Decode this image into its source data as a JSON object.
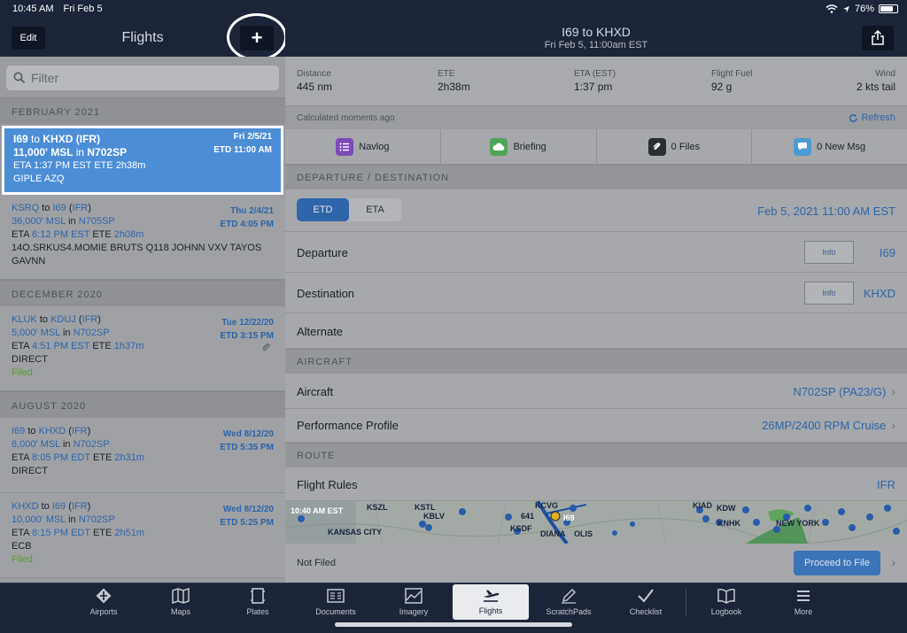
{
  "status": {
    "time": "10:45 AM",
    "date": "Fri Feb 5",
    "battery": "76%",
    "battery_level": 0.76
  },
  "sidebar": {
    "edit_label": "Edit",
    "title": "Flights",
    "add_label": "+",
    "filter_placeholder": "Filter",
    "sections": [
      {
        "header": "FEBRUARY 2021"
      },
      {
        "header": "DECEMBER 2020"
      },
      {
        "header": "AUGUST 2020"
      }
    ],
    "flights": [
      {
        "from": "I69",
        "to": "KHXD",
        "rules": "IFR",
        "alt": "11,000' MSL",
        "aircraft": "N702SP",
        "eta": "1:37 PM EST",
        "ete": "2h38m",
        "date": "Fri 2/5/21",
        "etd": "ETD 11:00 AM",
        "route": "GIPLE AZQ",
        "status": ""
      },
      {
        "from": "KSRQ",
        "to": "I69",
        "rules": "IFR",
        "alt": "36,000' MSL",
        "aircraft": "N705SP",
        "eta": "6:12 PM EST",
        "ete": "2h08m",
        "date": "Thu 2/4/21",
        "etd": "ETD 4:05 PM",
        "route": "14O.SRKUS4.MOMIE BRUTS Q118 JOHNN VXV TAYOS GAVNN",
        "status": ""
      },
      {
        "from": "KLUK",
        "to": "KDUJ",
        "rules": "IFR",
        "alt": "5,000' MSL",
        "aircraft": "N702SP",
        "eta": "4:51 PM EST",
        "ete": "1h37m",
        "date": "Tue 12/22/20",
        "etd": "ETD 3:15 PM",
        "route": "DIRECT",
        "status": "Filed"
      },
      {
        "from": "I69",
        "to": "KHXD",
        "rules": "IFR",
        "alt": "8,000' MSL",
        "aircraft": "N702SP",
        "eta": "8:05 PM EDT",
        "ete": "2h31m",
        "date": "Wed 8/12/20",
        "etd": "ETD 5:35 PM",
        "route": "DIRECT",
        "status": ""
      },
      {
        "from": "KHXD",
        "to": "I69",
        "rules": "IFR",
        "alt": "10,000' MSL",
        "aircraft": "N702SP",
        "eta": "8:15 PM EDT",
        "ete": "2h51m",
        "date": "Wed 8/12/20",
        "etd": "ETD 5:25 PM",
        "route": "ECB",
        "status": "Filed"
      }
    ],
    "words": {
      "to": "to",
      "in": "in",
      "eta": "ETA",
      "ete": "ETE"
    }
  },
  "detail": {
    "title": "I69 to KHXD",
    "subtitle": "Fri Feb 5, 11:00am EST",
    "stats": [
      {
        "label": "Distance",
        "value": "445 nm"
      },
      {
        "label": "ETE",
        "value": "2h38m"
      },
      {
        "label": "ETA (EST)",
        "value": "1:37 pm"
      },
      {
        "label": "Flight Fuel",
        "value": "92 g"
      },
      {
        "label": "Wind",
        "value": "2 kts tail"
      }
    ],
    "calc_text": "Calculated moments ago",
    "refresh_label": "Refresh",
    "tools": [
      {
        "label": "Navlog",
        "color": "#7b4bb8"
      },
      {
        "label": "Briefing",
        "color": "#4fa65a"
      },
      {
        "label": "0 Files",
        "color": "#2a2d33"
      },
      {
        "label": "0 New Msg",
        "color": "#4a9ad4"
      }
    ],
    "sec_departure": "DEPARTURE / DESTINATION",
    "seg_etd": "ETD",
    "seg_eta": "ETA",
    "departure_time": "Feb 5, 2021 11:00 AM EST",
    "departure_label": "Departure",
    "departure_value": "I69",
    "destination_label": "Destination",
    "destination_value": "KHXD",
    "info_label": "Info",
    "alternate_label": "Alternate",
    "sec_aircraft": "AIRCRAFT",
    "aircraft_label": "Aircraft",
    "aircraft_value": "N702SP (PA23/G)",
    "perf_label": "Performance Profile",
    "perf_value": "26MP/2400 RPM Cruise",
    "sec_route": "ROUTE",
    "rules_label": "Flight Rules",
    "rules_value": "IFR",
    "map_labels": [
      "10:40 AM EST",
      "KSTL",
      "KCVG",
      "KIAD",
      "KSZL",
      "KBLV",
      "641",
      "I69",
      "KDW",
      "KANSAS CITY",
      "KSDF",
      "DIANA",
      "OLIS",
      "KNHK",
      "NEW YORK"
    ],
    "not_filed": "Not Filed",
    "proceed_label": "Proceed to File"
  },
  "tabbar": [
    {
      "label": "Airports",
      "icon": "airports-icon"
    },
    {
      "label": "Maps",
      "icon": "maps-icon"
    },
    {
      "label": "Plates",
      "icon": "plates-icon"
    },
    {
      "label": "Documents",
      "icon": "documents-icon"
    },
    {
      "label": "Imagery",
      "icon": "imagery-icon"
    },
    {
      "label": "Flights",
      "icon": "flights-icon"
    },
    {
      "label": "ScratchPads",
      "icon": "scratchpads-icon"
    },
    {
      "label": "Checklist",
      "icon": "checklist-icon"
    },
    {
      "label": "Logbook",
      "icon": "logbook-icon"
    },
    {
      "label": "More",
      "icon": "more-icon"
    }
  ]
}
